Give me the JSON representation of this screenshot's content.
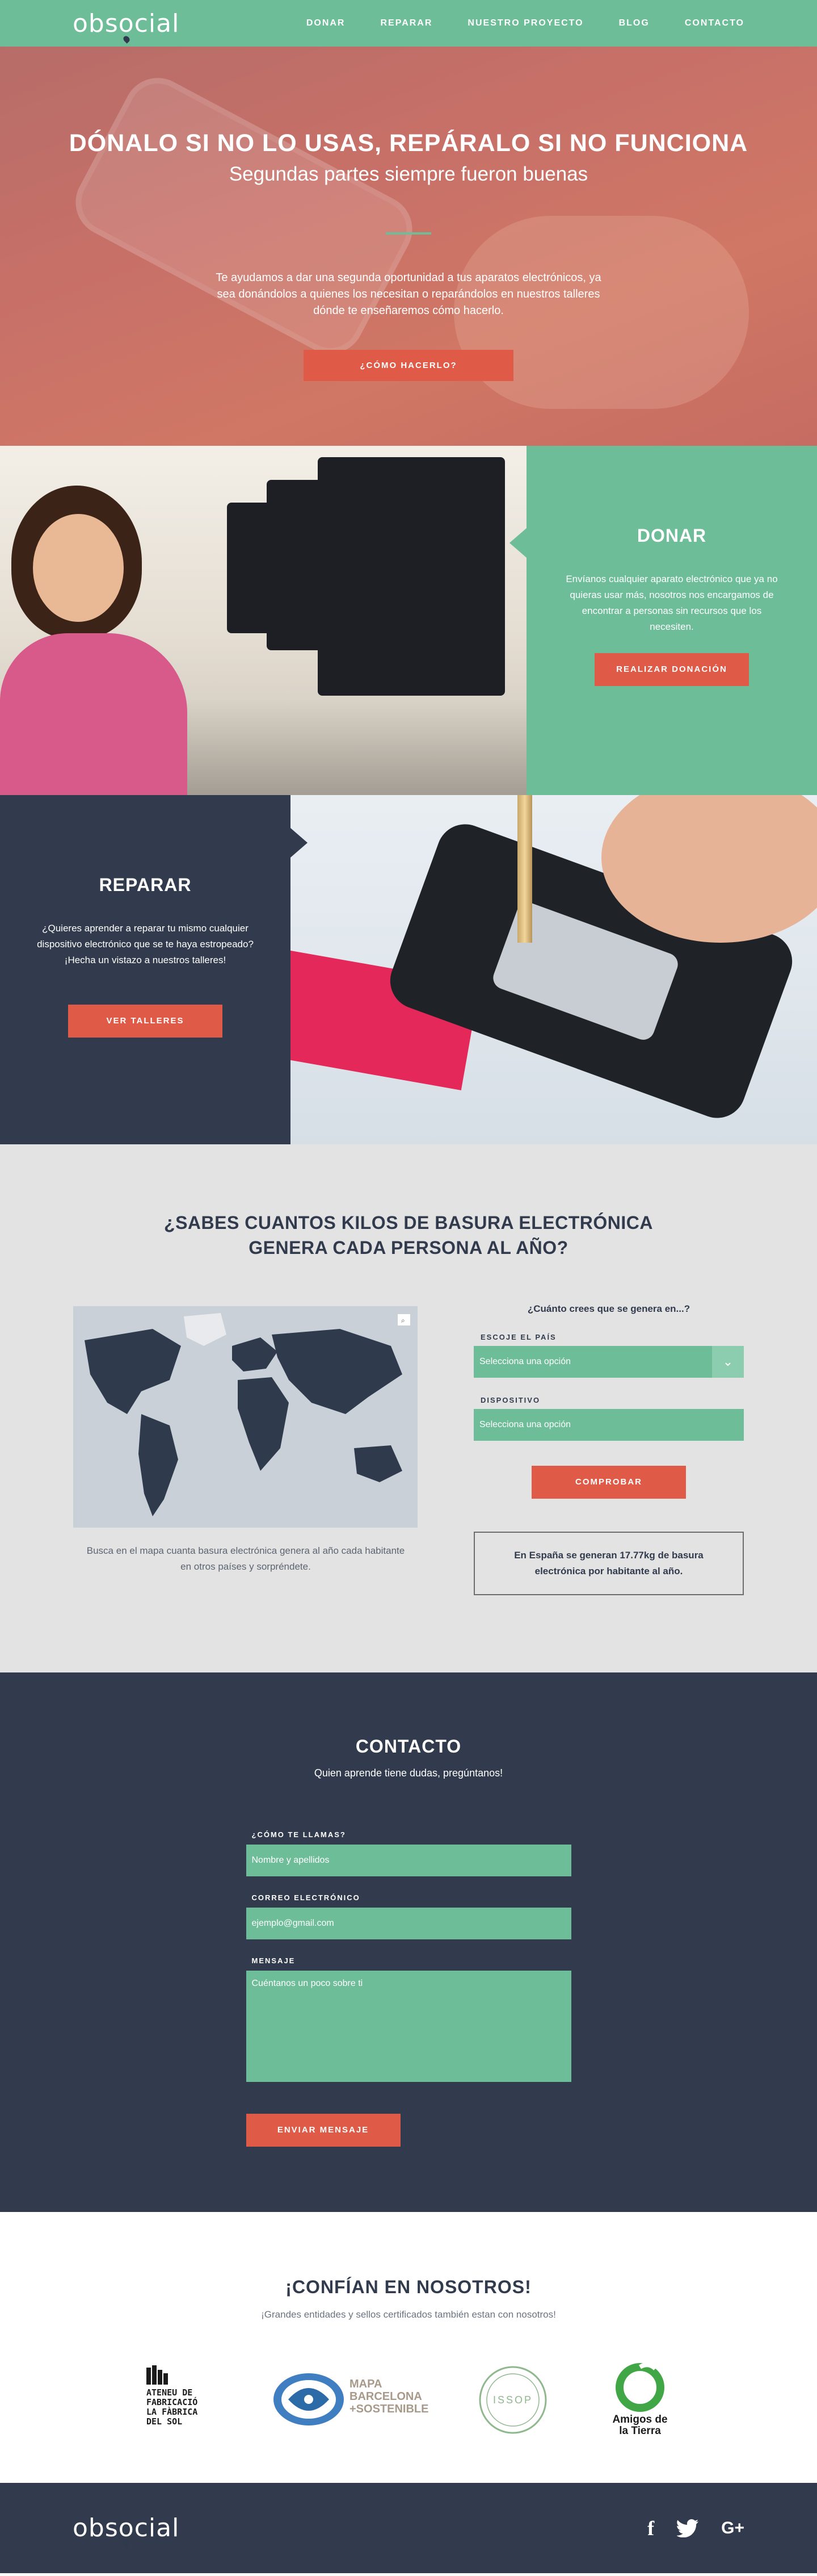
{
  "brand": {
    "logo_text_a": "obs",
    "logo_text_o": "o",
    "logo_text_b": "cial"
  },
  "nav": {
    "items": [
      "DONAR",
      "REPARAR",
      "NUESTRO PROYECTO",
      "BLOG",
      "CONTACTO"
    ]
  },
  "hero": {
    "title": "DÓNALO SI NO LO USAS, REPÁRALO SI NO FUNCIONA",
    "subtitle": "Segundas partes siempre fueron buenas",
    "text": "Te ayudamos a dar una segunda oportunidad a tus aparatos electrónicos, ya sea donándolos a quienes los necesitan o reparándolos en nuestros talleres dónde te enseñaremos cómo hacerlo.",
    "button": "¿CÓMO HACERLO?"
  },
  "donar": {
    "title": "DONAR",
    "text": "Envíanos cualquier aparato electrónico que ya no quieras usar más, nosotros nos encargamos de encontrar a personas sin recursos que los necesiten.",
    "button": "REALIZAR DONACIÓN"
  },
  "reparar": {
    "title": "REPARAR",
    "text": "¿Quieres aprender a reparar tu mismo cualquier dispositivo electrónico que se te haya estropeado? ¡Hecha un vistazo a nuestros talleres!",
    "button": "VER TALLERES"
  },
  "kilos": {
    "title_line1": "¿SABES CUANTOS KILOS DE BASURA ELECTRÓNICA",
    "title_line2": "GENERA CADA PERSONA AL AÑO?",
    "map_caption": "Busca en el mapa cuanta basura electrónica genera al año cada habitante en otros países y sorpréndete.",
    "question": "¿Cuánto crees que se genera en...?",
    "country_label": "ESCOJE EL PAÍS",
    "country_value": "Selecciona una opción",
    "device_label": "DISPOSITIVO",
    "device_value": "Selecciona una opción",
    "button": "COMPROBAR",
    "result": "En España se generan 17.77kg de basura electrónica por habitante al año."
  },
  "contacto": {
    "title": "CONTACTO",
    "subtitle": "Quien aprende tiene dudas, pregúntanos!",
    "name_label": "¿CÓMO TE LLAMAS?",
    "name_placeholder": "Nombre y apellidos",
    "email_label": "CORREO ELECTRÓNICO",
    "email_placeholder": "ejemplo@gmail.com",
    "message_label": "MENSAJE",
    "message_placeholder": "Cuéntanos un poco sobre ti",
    "button": "ENVIAR MENSAJE"
  },
  "confian": {
    "title": "¡CONFÍAN EN NOSOTROS!",
    "subtitle": "¡Grandes entidades y sellos certificados también estan con nosotros!",
    "logo1_lines": [
      "ATENEU DE",
      "FABRICACIÓ",
      "LA FÀBRICA",
      "DEL SOL"
    ],
    "logo2_lines": [
      "MAPA",
      "BARCELONA",
      "+SOSTENIBLE"
    ],
    "logo3_text": "ISSOP",
    "logo4_lines": [
      "Amigos de",
      "la Tierra"
    ]
  },
  "footer": {
    "social": [
      "f",
      "twitter-bird",
      "G+"
    ]
  }
}
